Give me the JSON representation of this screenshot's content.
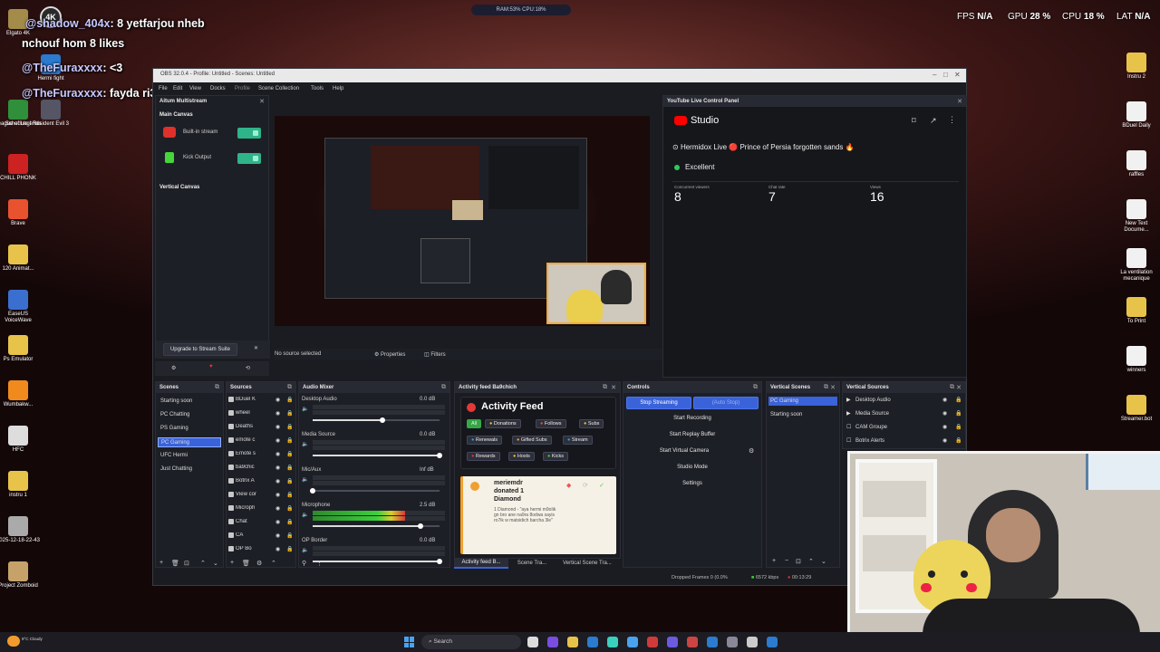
{
  "overlay": {
    "viewer_count": "4K",
    "top_center": "RAM:53% CPU:18%",
    "chat": [
      {
        "user": "@shadow_404x",
        "text": ": 8 yetfarjou nheb"
      },
      {
        "user": "",
        "text": "nchouf hom 8 likes"
      },
      {
        "user": "@TheFuraxxxx",
        "text": ": <3"
      },
      {
        "user": "@TheFuraxxxx",
        "text": ": fayda ri3na"
      }
    ],
    "stats": {
      "fps_label": "FPS",
      "fps": "N/A",
      "gpu_label": "GPU",
      "gpu": "28 %",
      "cpu_label": "CPU",
      "cpu": "18 %",
      "lat_label": "LAT",
      "lat": "N/A"
    }
  },
  "desktop": {
    "left_icons": [
      "Elgato 4K",
      "Hermi fight",
      "League of Legends",
      "Schedule I",
      "Resident Evil 3",
      "CHILL PHONK",
      "Brave",
      "120 Animat...",
      "EaseUS VoiceWave",
      "Ps Emulator",
      "Wumbakw...",
      "HFC",
      "instru 1",
      "2025-12-18-22-43",
      "Project Zomboid"
    ],
    "right_icons": [
      "Instru 2",
      "BDuel Daily",
      "raffles",
      "New Text Docume...",
      "La ventilation mecanique",
      "To Print",
      "winners",
      "Streamer.bot"
    ]
  },
  "obs": {
    "title": "OBS 32.0.4 - Profile: Untitled - Scenes: Untitled",
    "menu": [
      "File",
      "Edit",
      "View",
      "Docks",
      "Profile",
      "Scene Collection",
      "Tools",
      "Help"
    ],
    "multistream": {
      "title": "Aitum Multistream",
      "main_canvas": "Main Canvas",
      "outputs": [
        "Built-in stream",
        "Kick Output"
      ],
      "vertical_canvas": "Vertical Canvas",
      "upgrade": "Upgrade to Stream Suite"
    },
    "yt": {
      "panel_title": "YouTube Live Control Panel",
      "brand": "Studio",
      "stream_title": "Hermidox Live 🔴 Prince of Persia forgotten sands 🔥",
      "health": "Excellent",
      "metrics": [
        {
          "label": "Concurrent viewers",
          "value": "8"
        },
        {
          "label": "Chat rate",
          "value": "7"
        },
        {
          "label": "Views",
          "value": "16"
        }
      ]
    },
    "preview_bar": {
      "no_source": "No source selected",
      "properties": "Properties",
      "filters": "Filters"
    },
    "scenes": {
      "title": "Scenes",
      "items": [
        "Starting soon",
        "PC Chatting",
        "PS Gaming",
        "PC Gaming",
        "UFC Hermi",
        "Just Chatting"
      ],
      "selected": 3
    },
    "sources": {
      "title": "Sources",
      "items": [
        "BDuel K",
        "wheel",
        "Deaths",
        "emote c",
        "Emote s",
        "ba9chic",
        "Botrix A",
        "View cor",
        "Microph",
        "Chat",
        "CA",
        "OP Bo"
      ]
    },
    "mixer": {
      "title": "Audio Mixer",
      "channels": [
        {
          "name": "Desktop Audio",
          "db": "0.0 dB",
          "level": 0.0,
          "vol": 0.55
        },
        {
          "name": "Media Source",
          "db": "0.0 dB",
          "level": 0.0,
          "vol": 1.0
        },
        {
          "name": "Mic/Aux",
          "db": "Inf dB",
          "level": 0.0,
          "vol": 0.0
        },
        {
          "name": "Microphone",
          "db": "2.5 dB",
          "level": 0.7,
          "vol": 0.85
        },
        {
          "name": "OP Border",
          "db": "0.0 dB",
          "level": 0.0,
          "vol": 1.0
        }
      ]
    },
    "activity": {
      "panel_title": "Activity feed Ba9chich",
      "title": "Activity Feed",
      "filters": [
        "All",
        "Donations",
        "Follows",
        "Subs",
        "Renewals",
        "Gifted Subs",
        "Stream",
        "Rewards",
        "Hosts",
        "Kicks"
      ],
      "event": {
        "user": "meriemdr",
        "line1": "donated 1",
        "line2": "Diamond",
        "detail": "1 Diamond - \"aya hermi m9olik gn bro ane na9ra 8odwa sayis ro7ik w matsidich barcha 3le\""
      }
    },
    "controls": {
      "title": "Controls",
      "stop": "Stop Streaming",
      "auto": "(Auto Stop)",
      "buttons": [
        "Start Recording",
        "Start Replay Buffer",
        "Start Virtual Camera",
        "Studio Mode",
        "Settings"
      ]
    },
    "vscenes": {
      "title": "Vertical Scenes",
      "items": [
        "PC Gaming",
        "Starting soon"
      ]
    },
    "vsources": {
      "title": "Vertical Sources",
      "items": [
        "Desktop Audio",
        "Media Source",
        "CAM Groupe",
        "Botrix Alerts"
      ]
    },
    "tabs": [
      "Activity feed B...",
      "Scene Tra...",
      "Vertical Scene Tra..."
    ],
    "status": {
      "dropped": "Dropped Frames 0 (0.0%",
      "bitrate": "6572 kbps",
      "time": "00:13:29"
    }
  },
  "taskbar": {
    "weather": "9°C Cloudy",
    "search": "Search"
  }
}
